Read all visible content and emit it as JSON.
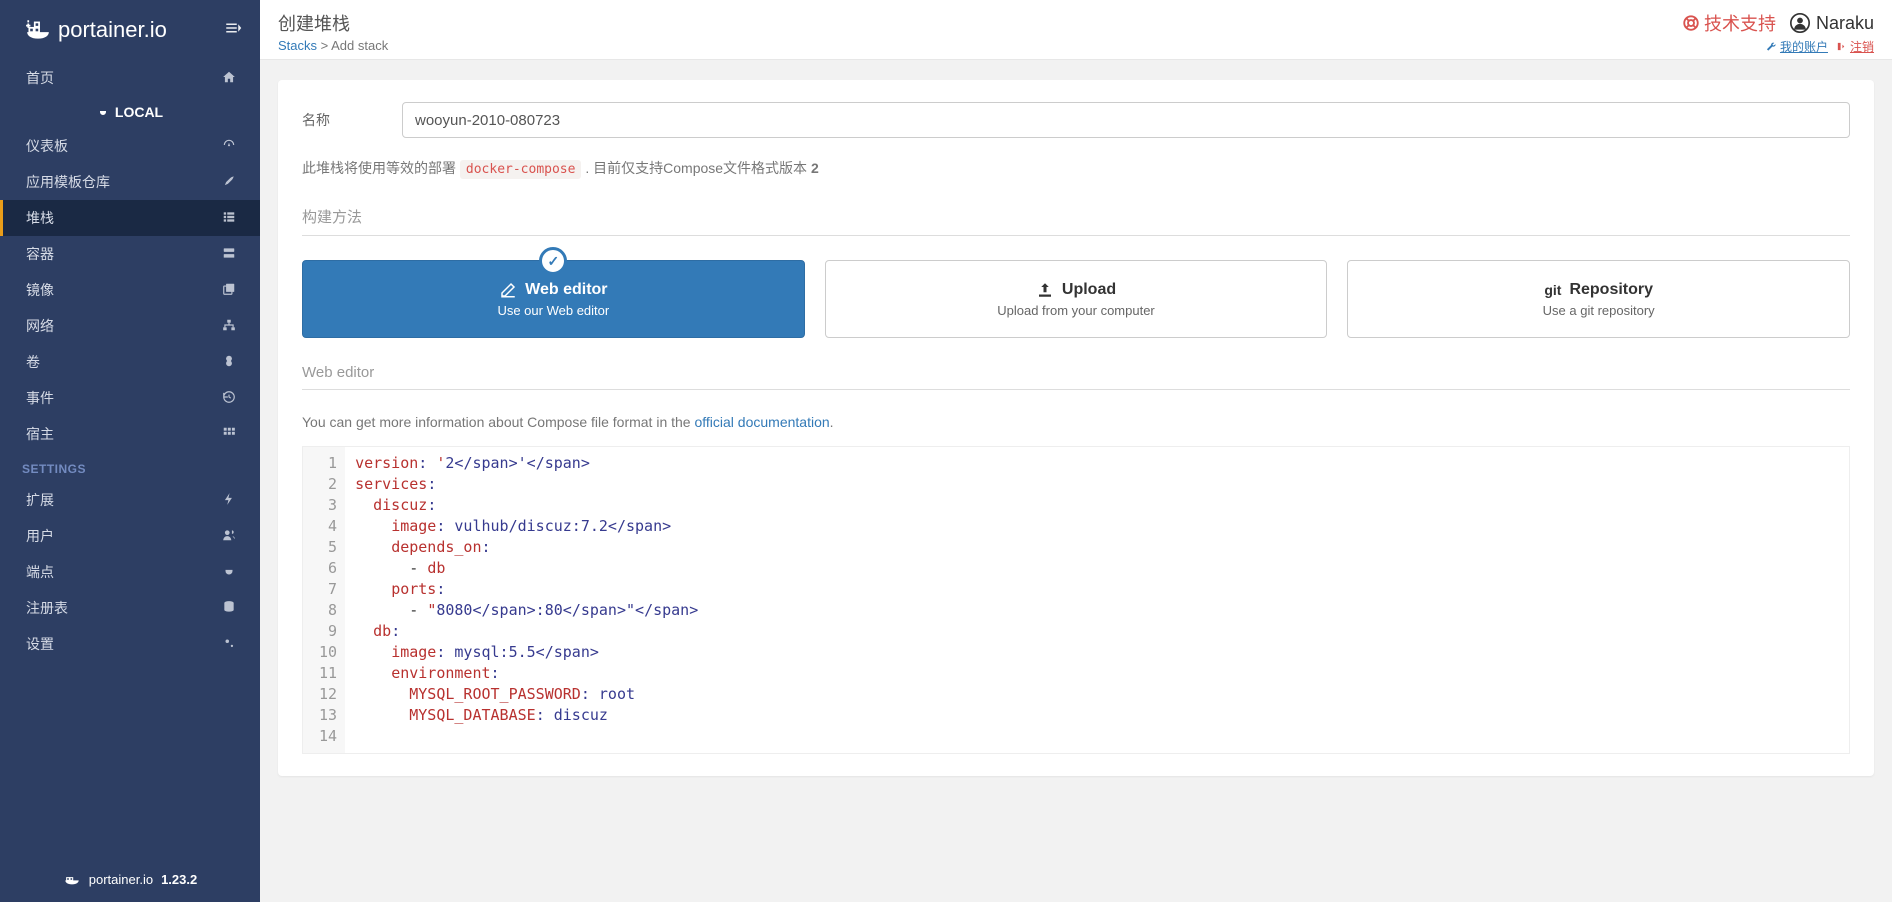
{
  "brand": "portainer.io",
  "version": "1.23.2",
  "sidebar": {
    "toggle_icon": "toggle",
    "section_local": "LOCAL",
    "settings_heading": "SETTINGS",
    "items_top": [
      {
        "label": "首页",
        "icon": "home-icon"
      }
    ],
    "items_local": [
      {
        "label": "仪表板",
        "icon": "dashboard-icon"
      },
      {
        "label": "应用模板仓库",
        "icon": "rocket-icon"
      },
      {
        "label": "堆栈",
        "icon": "list-icon",
        "active": true
      },
      {
        "label": "容器",
        "icon": "server-icon"
      },
      {
        "label": "镜像",
        "icon": "clone-icon"
      },
      {
        "label": "网络",
        "icon": "sitemap-icon"
      },
      {
        "label": "卷",
        "icon": "hdd-icon"
      },
      {
        "label": "事件",
        "icon": "history-icon"
      },
      {
        "label": "宿主",
        "icon": "th-icon"
      }
    ],
    "items_settings": [
      {
        "label": "扩展",
        "icon": "bolt-icon"
      },
      {
        "label": "用户",
        "icon": "users-icon"
      },
      {
        "label": "端点",
        "icon": "plug-icon"
      },
      {
        "label": "注册表",
        "icon": "database-icon"
      },
      {
        "label": "设置",
        "icon": "cogs-icon"
      }
    ]
  },
  "header": {
    "title": "创建堆栈",
    "breadcrumb_link": "Stacks",
    "breadcrumb_rest": " > Add stack",
    "support": "技术支持",
    "user": "Naraku",
    "my_account": "我的账户",
    "logout": "注销"
  },
  "form": {
    "name_label": "名称",
    "name_value": "wooyun-2010-080723",
    "info_pre": "此堆栈将使用等效的部署 ",
    "info_code": "docker-compose",
    "info_post": " . 目前仅支持Compose文件格式版本 ",
    "info_bold": "2",
    "build_method": "构建方法",
    "cards": {
      "web": {
        "title": "Web editor",
        "sub": "Use our Web editor"
      },
      "upload": {
        "title": "Upload",
        "sub": "Upload from your computer"
      },
      "repo": {
        "title": "Repository",
        "sub": "Use a git repository"
      }
    },
    "editor_section": "Web editor",
    "doc_pre": "You can get more information about Compose file format in the ",
    "doc_link": "official documentation",
    "doc_post": "."
  },
  "code_lines": [
    "version: '2'",
    "services:",
    "  discuz:",
    "    image: vulhub/discuz:7.2",
    "    depends_on:",
    "      - db",
    "    ports:",
    "      - \"8080:80\"",
    "  db:",
    "    image: mysql:5.5",
    "    environment:",
    "      MYSQL_ROOT_PASSWORD: root",
    "      MYSQL_DATABASE: discuz",
    ""
  ]
}
